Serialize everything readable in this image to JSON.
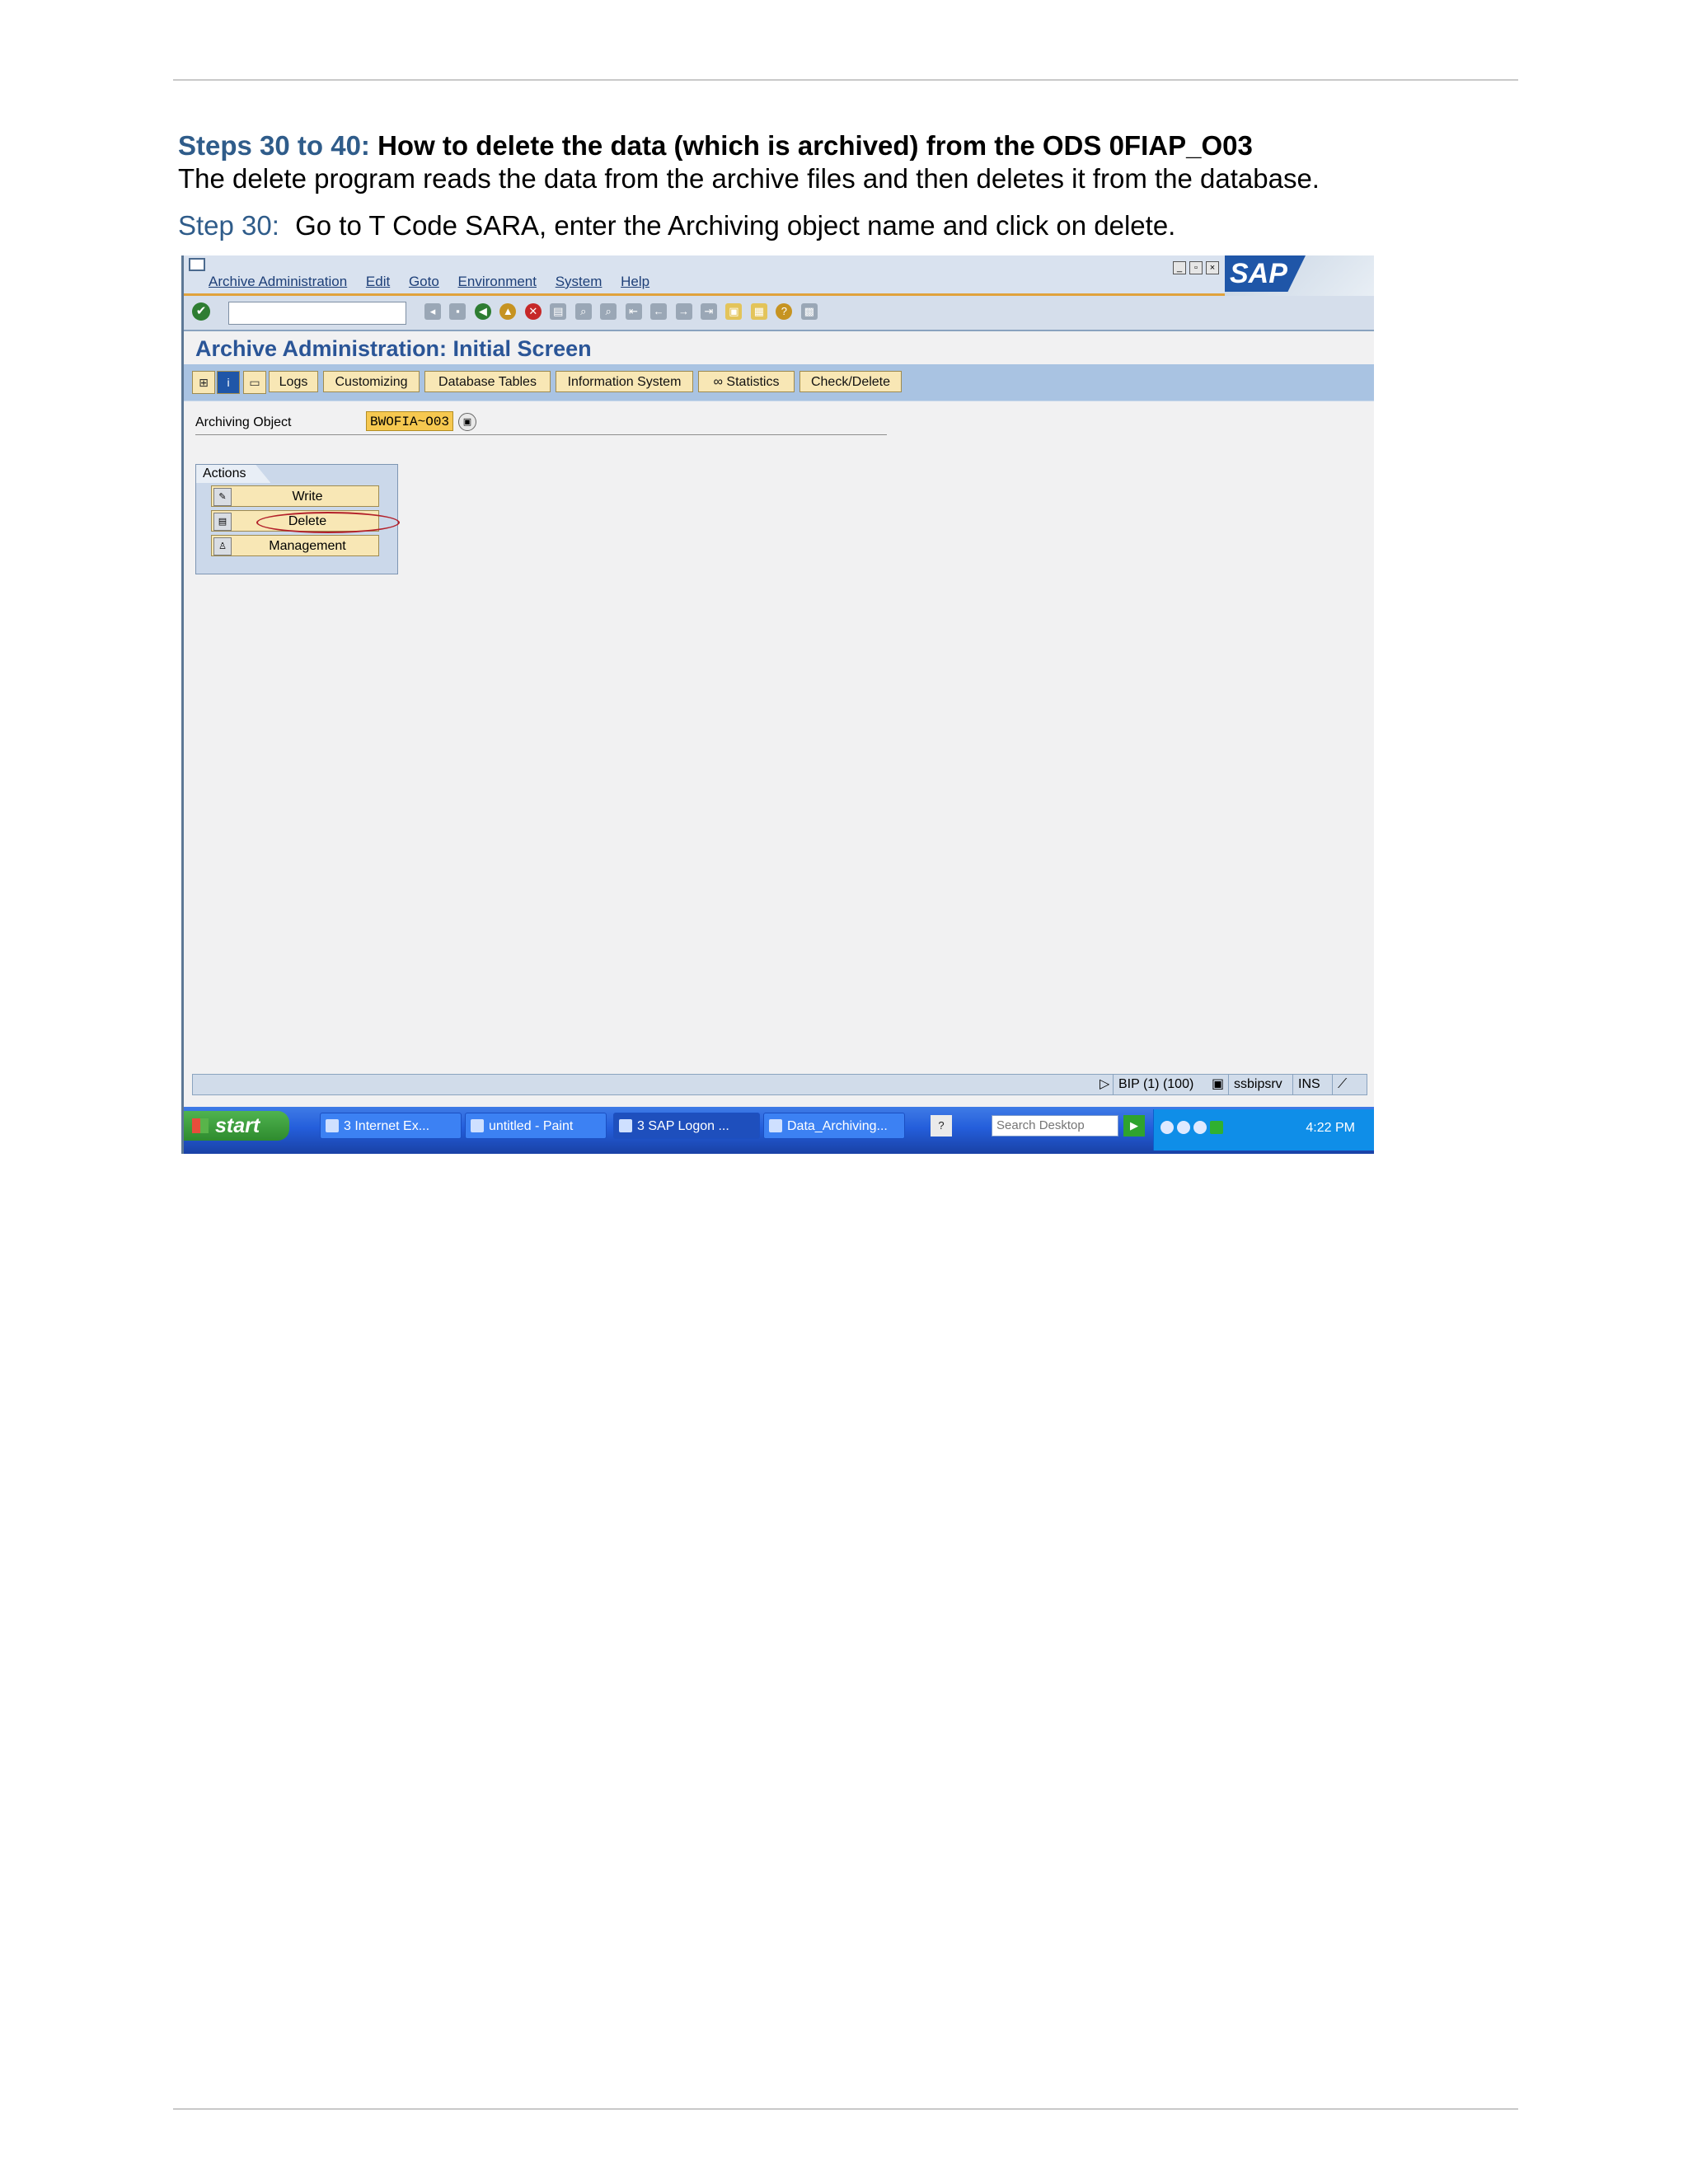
{
  "document": {
    "heading_lead": "Steps 30 to 40:",
    "heading_text": "How to delete the data (which is archived) from the ODS 0FIAP_O03",
    "intro": "The delete program reads the data from the archive files and then deletes it from the database.",
    "step_lead": "Step 30:",
    "step_text": "Go to T Code SARA, enter the Archiving object name and click on delete."
  },
  "sap": {
    "menu": [
      "Archive Administration",
      "Edit",
      "Goto",
      "Environment",
      "System",
      "Help"
    ],
    "logo_text": "SAP",
    "screen_title": "Archive Administration: Initial Screen",
    "app_toolbar": {
      "logs": "Logs",
      "customizing": "Customizing",
      "database_tables": "Database Tables",
      "information_system": "Information System",
      "statistics": "Statistics",
      "check_delete": "Check/Delete"
    },
    "archiving_object": {
      "label": "Archiving Object",
      "value": "BWOFIA~O03"
    },
    "actions": {
      "title": "Actions",
      "write": "Write",
      "delete": "Delete",
      "management": "Management"
    },
    "status": {
      "system": "BIP (1) (100)",
      "server": "ssbipsrv",
      "mode": "INS"
    }
  },
  "taskbar": {
    "start": "start",
    "tasks": [
      "3 Internet Ex...",
      "untitled - Paint",
      "3 SAP Logon ...",
      "Data_Archiving..."
    ],
    "search_placeholder": "Search Desktop",
    "clock": "4:22 PM"
  }
}
